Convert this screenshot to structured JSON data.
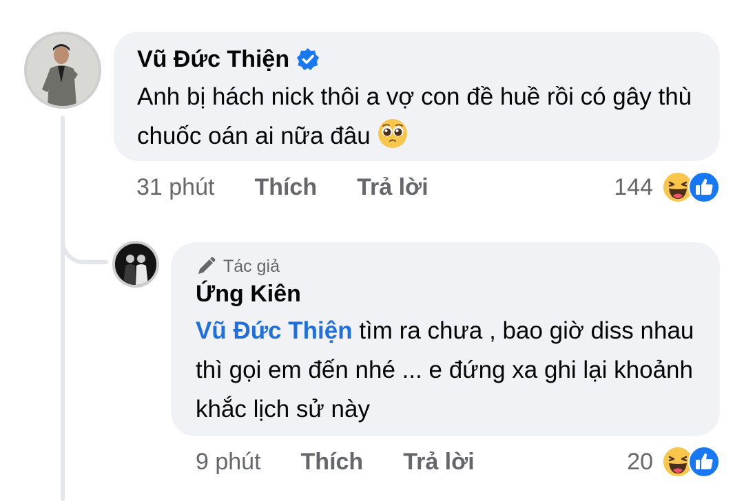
{
  "comment": {
    "author": "Vũ Đức Thiện",
    "verified": true,
    "text": "Anh bị hách nick thôi a vợ con đề huề rồi có gây thù chuốc oán ai nữa đâu",
    "emoji": "pleading-face",
    "time": "31 phút",
    "like_label": "Thích",
    "reply_label": "Trả lời",
    "reaction_count": "144",
    "reaction_icons": [
      "haha",
      "like"
    ]
  },
  "reply": {
    "badge": "Tác giả",
    "author": "Ứng Kiên",
    "mention": "Vũ Đức Thiện",
    "text": " tìm ra chưa , bao giờ diss nhau thì gọi em đến nhé ... e đứng xa ghi lại khoảnh khắc lịch sử này",
    "time": "9 phút",
    "like_label": "Thích",
    "reply_label": "Trả lời",
    "reaction_count": "20",
    "reaction_icons": [
      "haha",
      "like"
    ]
  },
  "colors": {
    "bubble": "#f0f2f5",
    "mention": "#216fdb",
    "secondary_text": "#65676b",
    "verified": "#1877f2",
    "like_blue": "#1877f2",
    "haha_yellow": "#f7c64b"
  }
}
